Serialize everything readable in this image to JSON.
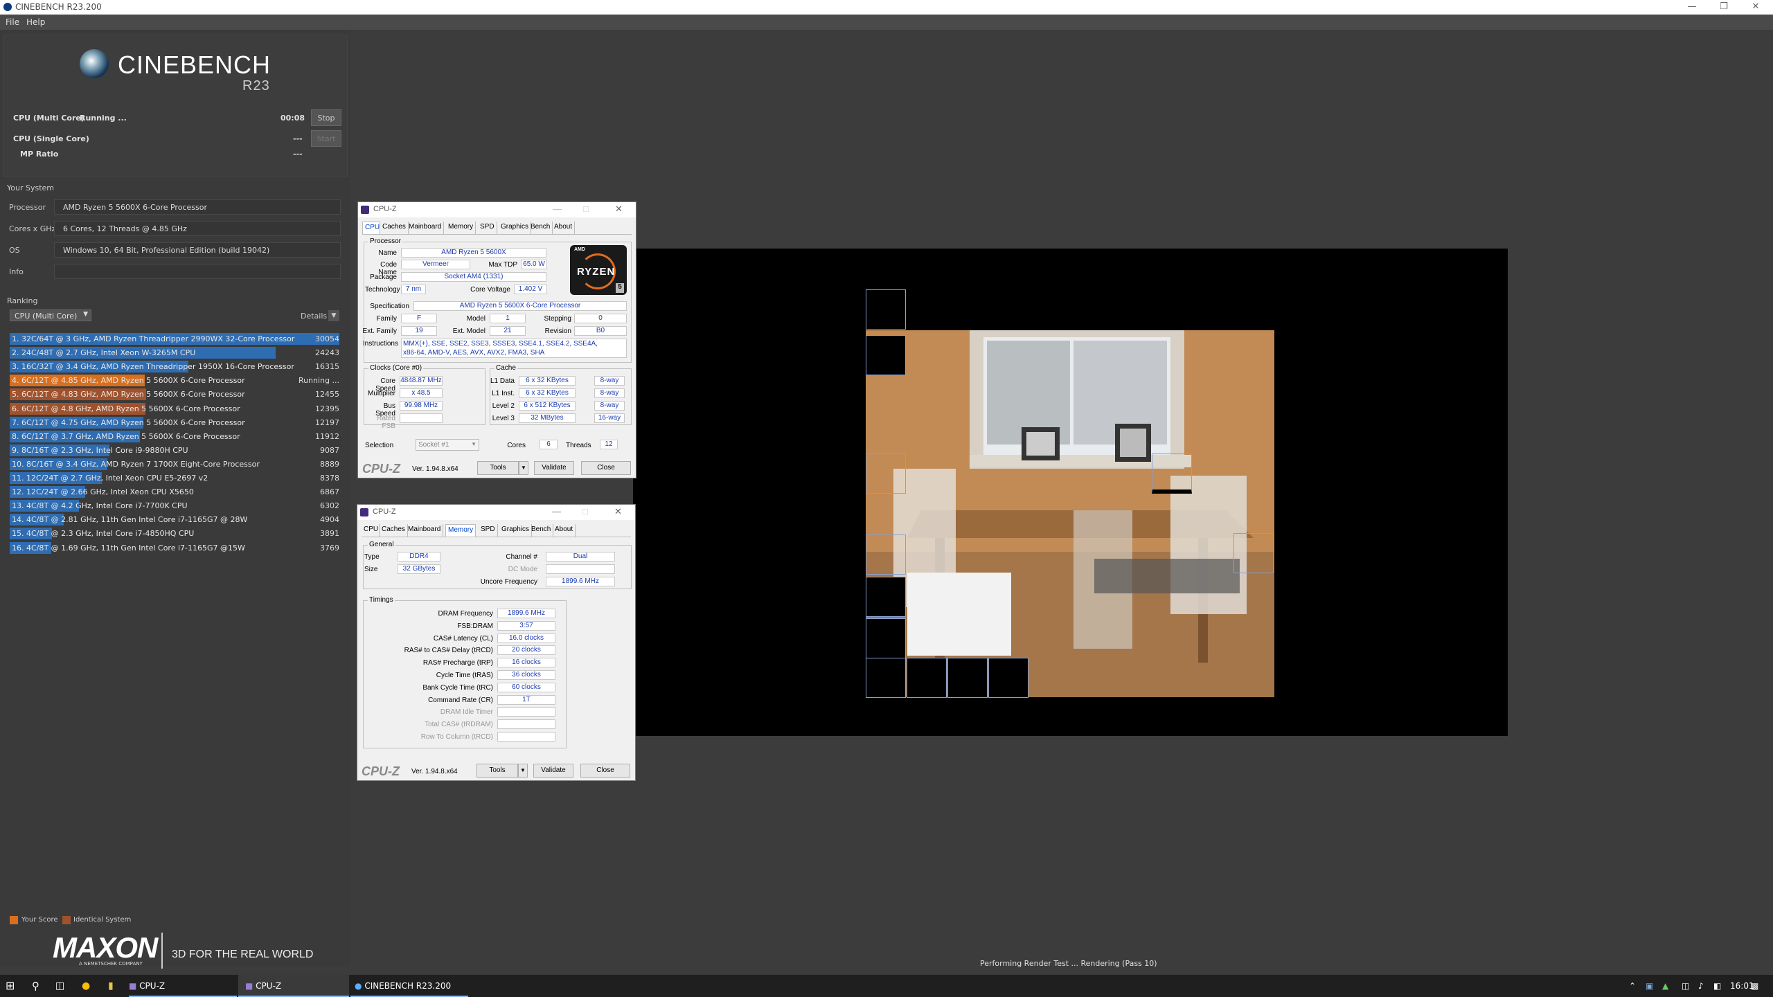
{
  "window": {
    "title": "CINEBENCH R23.200"
  },
  "menu": [
    "File",
    "Help"
  ],
  "logo": {
    "name": "CINEBENCH",
    "version": "R23"
  },
  "tests": [
    {
      "label": "CPU (Multi Core)",
      "status": "Running ...",
      "time": "00:08",
      "button": "Stop"
    },
    {
      "label": "CPU (Single Core)",
      "status": "",
      "time": "---",
      "button": "Start"
    },
    {
      "label": "MP Ratio",
      "status": "",
      "time": "---",
      "button": ""
    }
  ],
  "system": {
    "heading": "Your System",
    "rows": [
      {
        "k": "Processor",
        "v": "AMD Ryzen 5 5600X 6-Core Processor"
      },
      {
        "k": "Cores x GHz",
        "v": "6 Cores, 12 Threads @ 4.85 GHz"
      },
      {
        "k": "OS",
        "v": "Windows 10, 64 Bit, Professional Edition (build 19042)"
      },
      {
        "k": "Info",
        "v": ""
      }
    ]
  },
  "ranking": {
    "heading": "Ranking",
    "select": "CPU (Multi Core)",
    "details": "Details",
    "items": [
      {
        "label": "1. 32C/64T @ 3 GHz, AMD Ryzen Threadripper 2990WX 32-Core Processor",
        "score": "30054",
        "fill": 1.0,
        "kind": "blue"
      },
      {
        "label": "2. 24C/48T @ 2.7 GHz, Intel Xeon W-3265M CPU",
        "score": "24243",
        "fill": 0.807,
        "kind": "blue"
      },
      {
        "label": "3. 16C/32T @ 3.4 GHz, AMD Ryzen Threadripper 1950X 16-Core Processor",
        "score": "16315",
        "fill": 0.543,
        "kind": "blue"
      },
      {
        "label": "4. 6C/12T @ 4.85 GHz, AMD Ryzen 5 5600X 6-Core Processor",
        "score": "Running ...",
        "fill": 0.41,
        "kind": "orange"
      },
      {
        "label": "5. 6C/12T @ 4.83 GHz, AMD Ryzen 5 5600X 6-Core Processor",
        "score": "12455",
        "fill": 0.414,
        "kind": "brown"
      },
      {
        "label": "6. 6C/12T @ 4.8 GHz, AMD Ryzen 5 5600X 6-Core Processor",
        "score": "12395",
        "fill": 0.412,
        "kind": "brown"
      },
      {
        "label": "7. 6C/12T @ 4.75 GHz, AMD Ryzen 5 5600X 6-Core Processor",
        "score": "12197",
        "fill": 0.406,
        "kind": "blue"
      },
      {
        "label": "8. 6C/12T @ 3.7 GHz, AMD Ryzen 5 5600X 6-Core Processor",
        "score": "11912",
        "fill": 0.396,
        "kind": "blue"
      },
      {
        "label": "9. 8C/16T @ 2.3 GHz, Intel Core i9-9880H CPU",
        "score": "9087",
        "fill": 0.302,
        "kind": "blue"
      },
      {
        "label": "10. 8C/16T @ 3.4 GHz, AMD Ryzen 7 1700X Eight-Core Processor",
        "score": "8889",
        "fill": 0.296,
        "kind": "blue"
      },
      {
        "label": "11. 12C/24T @ 2.7 GHz, Intel Xeon CPU E5-2697 v2",
        "score": "8378",
        "fill": 0.279,
        "kind": "blue"
      },
      {
        "label": "12. 12C/24T @ 2.66 GHz, Intel Xeon CPU X5650",
        "score": "6867",
        "fill": 0.228,
        "kind": "blue"
      },
      {
        "label": "13. 4C/8T @ 4.2 GHz, Intel Core i7-7700K CPU",
        "score": "6302",
        "fill": 0.21,
        "kind": "blue"
      },
      {
        "label": "14. 4C/8T @ 2.81 GHz, 11th Gen Intel Core i7-1165G7 @ 28W",
        "score": "4904",
        "fill": 0.163,
        "kind": "blue"
      },
      {
        "label": "15. 4C/8T @ 2.3 GHz, Intel Core i7-4850HQ CPU",
        "score": "3891",
        "fill": 0.129,
        "kind": "blue"
      },
      {
        "label": "16. 4C/8T @ 1.69 GHz, 11th Gen Intel Core i7-1165G7 @15W",
        "score": "3769",
        "fill": 0.125,
        "kind": "blue"
      }
    ]
  },
  "legend": {
    "your": "Your Score",
    "identical": "Identical System"
  },
  "footer": {
    "brand": "MAXON",
    "sub": "A NEMETSCHEK COMPANY",
    "tagline": "3D FOR THE REAL WORLD"
  },
  "status": "Performing Render Test ... Rendering (Pass 10)",
  "colors": {
    "blue": "#2f6db3",
    "orange": "#d86f1e",
    "brown": "#a0522d"
  },
  "cpuz1": {
    "title": "CPU-Z",
    "tabs": [
      "CPU",
      "Caches",
      "Mainboard",
      "Memory",
      "SPD",
      "Graphics",
      "Bench",
      "About"
    ],
    "active": "CPU",
    "processor_group": "Processor",
    "name_l": "Name",
    "name": "AMD Ryzen 5 5600X",
    "code_l": "Code Name",
    "code": "Vermeer",
    "tdp_l": "Max TDP",
    "tdp": "65.0 W",
    "pkg_l": "Package",
    "pkg": "Socket AM4 (1331)",
    "tech_l": "Technology",
    "tech": "7 nm",
    "volt_l": "Core Voltage",
    "volt": "1.402 V",
    "spec_l": "Specification",
    "spec": "AMD Ryzen 5 5600X 6-Core Processor",
    "fam_l": "Family",
    "fam": "F",
    "model_l": "Model",
    "model": "1",
    "step_l": "Stepping",
    "step": "0",
    "efam_l": "Ext. Family",
    "efam": "19",
    "emodel_l": "Ext. Model",
    "emodel": "21",
    "rev_l": "Revision",
    "rev": "B0",
    "instr_l": "Instructions",
    "instr1": "MMX(+), SSE, SSE2, SSE3, SSSE3, SSE4.1, SSE4.2, SSE4A,",
    "instr2": "x86-64, AMD-V, AES, AVX, AVX2, FMA3, SHA",
    "clocks_group": "Clocks (Core #0)",
    "cs_l": "Core Speed",
    "cs": "4848.87 MHz",
    "mult_l": "Multiplier",
    "mult": "x 48.5",
    "bus_l": "Bus Speed",
    "bus": "99.98 MHz",
    "fsb_l": "Rated FSB",
    "fsb": "",
    "cache_group": "Cache",
    "l1d_l": "L1 Data",
    "l1d": "6 x 32 KBytes",
    "l1d_w": "8-way",
    "l1i_l": "L1 Inst.",
    "l1i": "6 x 32 KBytes",
    "l1i_w": "8-way",
    "l2_l": "Level 2",
    "l2": "6 x 512 KBytes",
    "l2_w": "8-way",
    "l3_l": "Level 3",
    "l3": "32 MBytes",
    "l3_w": "16-way",
    "sel_l": "Selection",
    "sel": "Socket #1",
    "cores_l": "Cores",
    "cores": "6",
    "threads_l": "Threads",
    "threads": "12",
    "brand": "CPU-Z",
    "ver": "Ver. 1.94.8.x64",
    "tools": "Tools",
    "validate": "Validate",
    "close": "Close",
    "badge_top": "AMD",
    "badge": "RYZEN",
    "badge_num": "5"
  },
  "cpuz2": {
    "title": "CPU-Z",
    "active": "Memory",
    "general_group": "General",
    "type_l": "Type",
    "type": "DDR4",
    "size_l": "Size",
    "size": "32 GBytes",
    "chan_l": "Channel #",
    "chan": "Dual",
    "dc_l": "DC Mode",
    "dc": "",
    "unc_l": "Uncore Frequency",
    "unc": "1899.6 MHz",
    "timings_group": "Timings",
    "timings": [
      {
        "k": "DRAM Frequency",
        "v": "1899.6 MHz",
        "dim": false
      },
      {
        "k": "FSB:DRAM",
        "v": "3:57",
        "dim": false
      },
      {
        "k": "CAS# Latency (CL)",
        "v": "16.0 clocks",
        "dim": false
      },
      {
        "k": "RAS# to CAS# Delay (tRCD)",
        "v": "20 clocks",
        "dim": false
      },
      {
        "k": "RAS# Precharge (tRP)",
        "v": "16 clocks",
        "dim": false
      },
      {
        "k": "Cycle Time (tRAS)",
        "v": "36 clocks",
        "dim": false
      },
      {
        "k": "Bank Cycle Time (tRC)",
        "v": "60 clocks",
        "dim": false
      },
      {
        "k": "Command Rate (CR)",
        "v": "1T",
        "dim": false
      },
      {
        "k": "DRAM Idle Timer",
        "v": "",
        "dim": true
      },
      {
        "k": "Total CAS# (tRDRAM)",
        "v": "",
        "dim": true
      },
      {
        "k": "Row To Column (tRCD)",
        "v": "",
        "dim": true
      }
    ]
  },
  "taskbar": {
    "items": [
      "CPU-Z",
      "CPU-Z",
      "CINEBENCH R23.200"
    ],
    "time": "16:01"
  }
}
